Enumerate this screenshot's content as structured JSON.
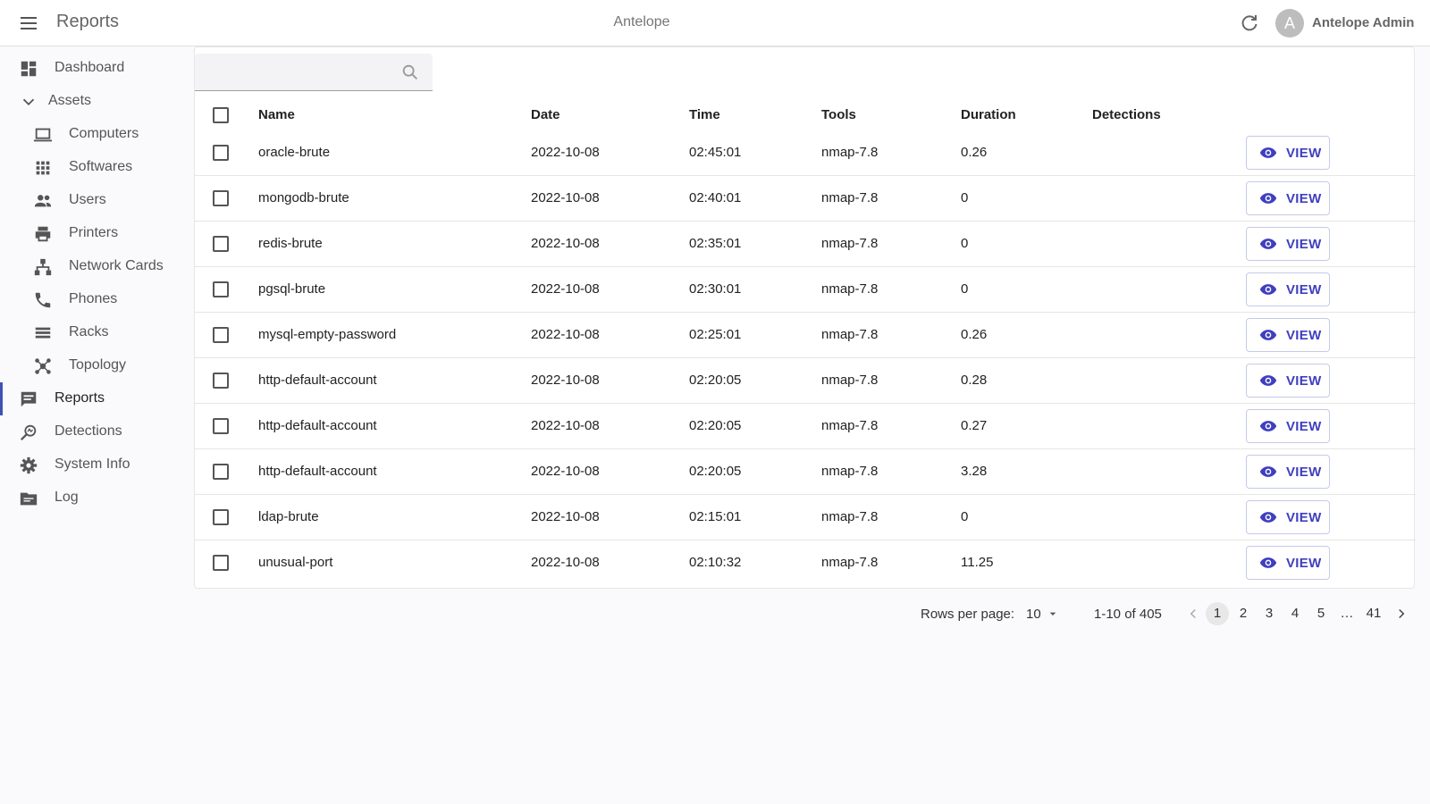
{
  "header": {
    "title": "Reports",
    "app_name": "Antelope",
    "avatar_letter": "A",
    "user_name": "Antelope Admin"
  },
  "sidebar": {
    "items": [
      {
        "label": "Dashboard",
        "icon": "dashboard-icon"
      },
      {
        "label": "Assets",
        "icon": "chevron-down-icon"
      },
      {
        "label": "Computers",
        "icon": "laptop-icon"
      },
      {
        "label": "Softwares",
        "icon": "apps-grid-icon"
      },
      {
        "label": "Users",
        "icon": "people-icon"
      },
      {
        "label": "Printers",
        "icon": "printer-icon"
      },
      {
        "label": "Network Cards",
        "icon": "network-icon"
      },
      {
        "label": "Phones",
        "icon": "phone-icon"
      },
      {
        "label": "Racks",
        "icon": "rack-list-icon"
      },
      {
        "label": "Topology",
        "icon": "topology-icon"
      },
      {
        "label": "Reports",
        "icon": "report-comment-icon"
      },
      {
        "label": "Detections",
        "icon": "detection-search-icon"
      },
      {
        "label": "System Info",
        "icon": "gear-icon"
      },
      {
        "label": "Log",
        "icon": "folder-log-icon"
      }
    ],
    "active": "Reports"
  },
  "search": {
    "placeholder": "",
    "value": ""
  },
  "table": {
    "columns": [
      "Name",
      "Date",
      "Time",
      "Tools",
      "Duration",
      "Detections"
    ],
    "view_label": "VIEW",
    "rows": [
      {
        "name": "oracle-brute",
        "date": "2022-10-08",
        "time": "02:45:01",
        "tools": "nmap-7.8",
        "duration": "0.26",
        "detections": ""
      },
      {
        "name": "mongodb-brute",
        "date": "2022-10-08",
        "time": "02:40:01",
        "tools": "nmap-7.8",
        "duration": "0",
        "detections": ""
      },
      {
        "name": "redis-brute",
        "date": "2022-10-08",
        "time": "02:35:01",
        "tools": "nmap-7.8",
        "duration": "0",
        "detections": ""
      },
      {
        "name": "pgsql-brute",
        "date": "2022-10-08",
        "time": "02:30:01",
        "tools": "nmap-7.8",
        "duration": "0",
        "detections": ""
      },
      {
        "name": "mysql-empty-password",
        "date": "2022-10-08",
        "time": "02:25:01",
        "tools": "nmap-7.8",
        "duration": "0.26",
        "detections": ""
      },
      {
        "name": "http-default-account",
        "date": "2022-10-08",
        "time": "02:20:05",
        "tools": "nmap-7.8",
        "duration": "0.28",
        "detections": ""
      },
      {
        "name": "http-default-account",
        "date": "2022-10-08",
        "time": "02:20:05",
        "tools": "nmap-7.8",
        "duration": "0.27",
        "detections": ""
      },
      {
        "name": "http-default-account",
        "date": "2022-10-08",
        "time": "02:20:05",
        "tools": "nmap-7.8",
        "duration": "3.28",
        "detections": ""
      },
      {
        "name": "ldap-brute",
        "date": "2022-10-08",
        "time": "02:15:01",
        "tools": "nmap-7.8",
        "duration": "0",
        "detections": ""
      },
      {
        "name": "unusual-port",
        "date": "2022-10-08",
        "time": "02:10:32",
        "tools": "nmap-7.8",
        "duration": "11.25",
        "detections": ""
      }
    ]
  },
  "pagination": {
    "rows_per_page_label": "Rows per page:",
    "rows_per_page": "10",
    "range": "1-10 of 405",
    "pages": [
      "1",
      "2",
      "3",
      "4",
      "5",
      "…",
      "41"
    ],
    "current_page": "1"
  },
  "colors": {
    "accent": "#3f51b5",
    "view_text": "#3f3fbf"
  }
}
